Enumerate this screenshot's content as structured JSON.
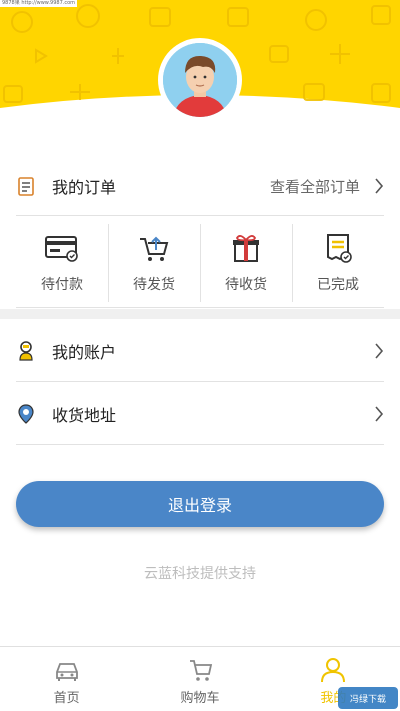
{
  "watermark_top": "9878果 http://www.9987.com",
  "colors": {
    "header_yellow": "#FFD500",
    "accent_blue": "#4A86C8",
    "active_tab": "#F0C400"
  },
  "orders": {
    "title": "我的订单",
    "view_all": "查看全部订单",
    "icon": "order-list-icon",
    "statuses": [
      {
        "label": "待付款",
        "icon": "wallet-card-icon"
      },
      {
        "label": "待发货",
        "icon": "cart-upload-icon"
      },
      {
        "label": "待收货",
        "icon": "gift-box-icon"
      },
      {
        "label": "已完成",
        "icon": "document-check-icon"
      }
    ]
  },
  "account": {
    "label": "我的账户",
    "icon": "user-account-icon"
  },
  "address": {
    "label": "收货地址",
    "icon": "location-pin-icon"
  },
  "logout_label": "退出登录",
  "support_text": "云蓝科技提供支持",
  "tabbar": [
    {
      "label": "首页",
      "icon": "car-home-icon",
      "active": false
    },
    {
      "label": "购物车",
      "icon": "shopping-cart-icon",
      "active": false
    },
    {
      "label": "我的",
      "icon": "person-icon",
      "active": true
    }
  ],
  "watermark_br": "冯绿下载"
}
